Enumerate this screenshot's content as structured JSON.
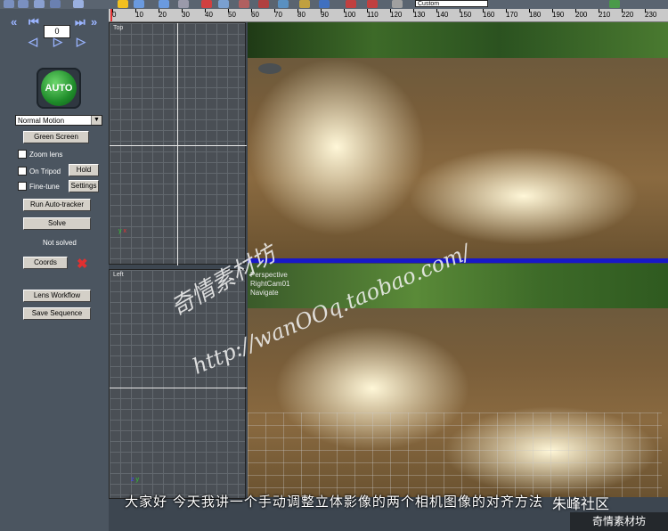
{
  "toolbar": {
    "items": [
      "undo-icon",
      "redo-icon",
      "open-icon",
      "save-icon",
      "z-icon",
      "gear-icon",
      "move-icon",
      "camera-icon",
      "pin-icon",
      "grid-icon",
      "layout-icon",
      "sphere-icon",
      "scale-icon",
      "view-icon",
      "flag-icon",
      "rotate-icon",
      "xy-icon",
      "xyz-icon",
      "key-icon"
    ],
    "dropdown_value": "Custom"
  },
  "frame": {
    "value": "0"
  },
  "left_panel": {
    "auto_label": "AUTO",
    "motion_type": "Normal Motion",
    "green_screen": "Green Screen",
    "zoom_lens": "Zoom lens",
    "on_tripod": "On Tripod",
    "hold": "Hold",
    "fine_tune": "Fine-tune",
    "settings": "Settings",
    "run_autotracker": "Run Auto-tracker",
    "solve": "Solve",
    "status": "Not solved",
    "coords": "Coords",
    "lens_workflow": "Lens Workflow",
    "save_sequence": "Save Sequence"
  },
  "ruler": {
    "ticks": [
      "0",
      "10",
      "20",
      "30",
      "40",
      "50",
      "60",
      "70",
      "80",
      "90",
      "100",
      "110",
      "120",
      "130",
      "140",
      "150",
      "160",
      "170",
      "180",
      "190",
      "200",
      "210",
      "220",
      "230"
    ]
  },
  "viewports": {
    "top": "Top",
    "left": "Left",
    "perspective_lines": [
      "Perspective",
      "RightCam01",
      "Navigate"
    ]
  },
  "watermarks": {
    "chinese": "奇情素材坊",
    "url": "http://wanOOq.taobao.com/"
  },
  "subtitle": "大家好 今天我讲一个手动调整立体影像的两个相机图像的对齐方法",
  "corner": {
    "logo": "朱峰社区",
    "sub": "奇情素材坊"
  },
  "colors": {
    "accent_blue": "#1818c8",
    "auto_green": "#1f8c2a",
    "playhead": "#e63030"
  }
}
